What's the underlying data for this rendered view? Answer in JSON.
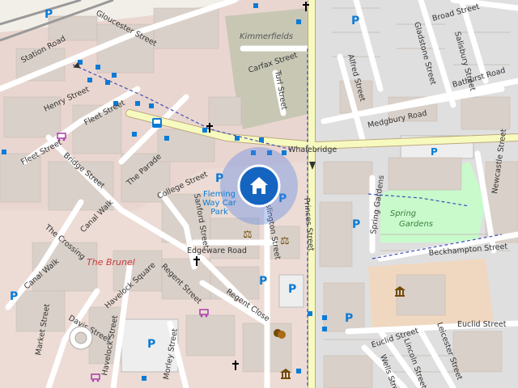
{
  "map": {
    "colors": {
      "background": "#f2efe9",
      "building": "#d9d0c9",
      "building_dark": "#cfc6bd",
      "road_major": "#f7fabf",
      "road_minor": "#ffffff",
      "residential": "#e0dfdf",
      "retail": "#ffd6d1",
      "park": "#c8facc",
      "grass": "#cdebb0",
      "parking": "#eeeeee",
      "rail": "#999999",
      "water_label": "#3f7f3f",
      "parking_icon": "#0b7bd6",
      "bus_stop": "#0b7bd6",
      "location_marker": "#1565c0",
      "location_halo": "#4f7fe8",
      "poi_red": "#c83c3c",
      "religious": "#000000",
      "museum": "#734a08",
      "shop": "#ac39ac"
    },
    "streets": [
      {
        "name": "Gloucester Street"
      },
      {
        "name": "Station Road"
      },
      {
        "name": "Henry Street"
      },
      {
        "name": "Fleet Street"
      },
      {
        "name": "Bridge Street"
      },
      {
        "name": "The Parade"
      },
      {
        "name": "College Street"
      },
      {
        "name": "Canal Walk"
      },
      {
        "name": "The Crossing"
      },
      {
        "name": "Havelock Square"
      },
      {
        "name": "Regent Street"
      },
      {
        "name": "Sanford Street"
      },
      {
        "name": "Edgeware Road"
      },
      {
        "name": "Regent Close"
      },
      {
        "name": "Islington Street"
      },
      {
        "name": "Princes Street"
      },
      {
        "name": "Whalebridge"
      },
      {
        "name": "Carfax Street"
      },
      {
        "name": "Turl Street"
      },
      {
        "name": "Alfred Street"
      },
      {
        "name": "Gladstone Street"
      },
      {
        "name": "Salisbury Street"
      },
      {
        "name": "Broad Street"
      },
      {
        "name": "Bathurst Road"
      },
      {
        "name": "Medgbury Road"
      },
      {
        "name": "Spring Gardens"
      },
      {
        "name": "Newcastle Street"
      },
      {
        "name": "Beckhampton Street"
      },
      {
        "name": "Euclid Street"
      },
      {
        "name": "Lincoln Street"
      },
      {
        "name": "Leicester Street"
      },
      {
        "name": "Wells Street"
      },
      {
        "name": "Market Street"
      },
      {
        "name": "Havelock Street"
      },
      {
        "name": "Morley Street"
      },
      {
        "name": "Davis Street"
      }
    ],
    "places": {
      "kimmerfields": "Kimmerfields",
      "spring_gardens": "Spring Gardens",
      "the_brunel": "The Brunel",
      "fleming_way": "Fleming Way Car Park"
    },
    "fleming_lines": [
      "Fleming",
      "Way Car",
      "Park"
    ],
    "spring_lines": [
      "Spring",
      "Gardens"
    ],
    "icons": [
      "parking-icon",
      "bus-stop-icon",
      "church-icon",
      "courthouse-icon",
      "museum-icon",
      "shop-icon",
      "theatre-icon",
      "location-home-icon"
    ],
    "parking_symbol": "P"
  }
}
